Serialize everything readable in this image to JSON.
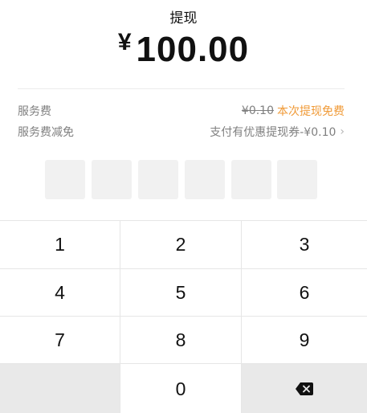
{
  "header": {
    "title": "提现",
    "currency_symbol": "¥",
    "amount": "100.00"
  },
  "fees": {
    "service_fee_label": "服务费",
    "service_fee_original": "¥0.10",
    "service_fee_note": "本次提现免费",
    "fee_waiver_label": "服务费减免",
    "fee_waiver_value": "支付有优惠提现券-¥0.10",
    "accent_color": "#f09a37"
  },
  "pin": {
    "length": 6,
    "entered": 0
  },
  "keypad": {
    "keys": [
      "1",
      "2",
      "3",
      "4",
      "5",
      "6",
      "7",
      "8",
      "9",
      "0"
    ],
    "delete_icon": "backspace-icon"
  }
}
